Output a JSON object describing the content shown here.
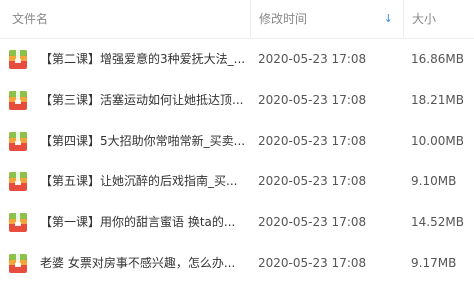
{
  "header": {
    "name_label": "文件名",
    "time_label": "修改时间",
    "size_label": "大小",
    "sort_indicator": "↓"
  },
  "files": [
    {
      "name": "【第二课】增强爱意的3种爱抚大法_...",
      "modified": "2020-05-23 17:08",
      "size": "16.86MB",
      "icon": "archive-file-icon"
    },
    {
      "name": "【第三课】活塞运动如何让她抵达顶...",
      "modified": "2020-05-23 17:08",
      "size": "18.21MB",
      "icon": "archive-file-icon"
    },
    {
      "name": "【第四课】5大招助你常啪常新_买卖...",
      "modified": "2020-05-23 17:08",
      "size": "10.00MB",
      "icon": "archive-file-icon"
    },
    {
      "name": "【第五课】让她沉醉的后戏指南_买...",
      "modified": "2020-05-23 17:08",
      "size": "9.10MB",
      "icon": "archive-file-icon"
    },
    {
      "name": "【第一课】用你的甜言蜜语 换ta的...",
      "modified": "2020-05-23 17:08",
      "size": "14.52MB",
      "icon": "archive-file-icon"
    },
    {
      "name": "老婆 女票对房事不感兴趣，怎么办...",
      "modified": "2020-05-23 17:08",
      "size": "9.17MB",
      "icon": "archive-file-icon"
    }
  ],
  "colors": {
    "accent": "#3b8fe6",
    "archive_top": "#8bc34a",
    "archive_bottom": "#f4a63a",
    "archive_body": "#e84c3d"
  }
}
